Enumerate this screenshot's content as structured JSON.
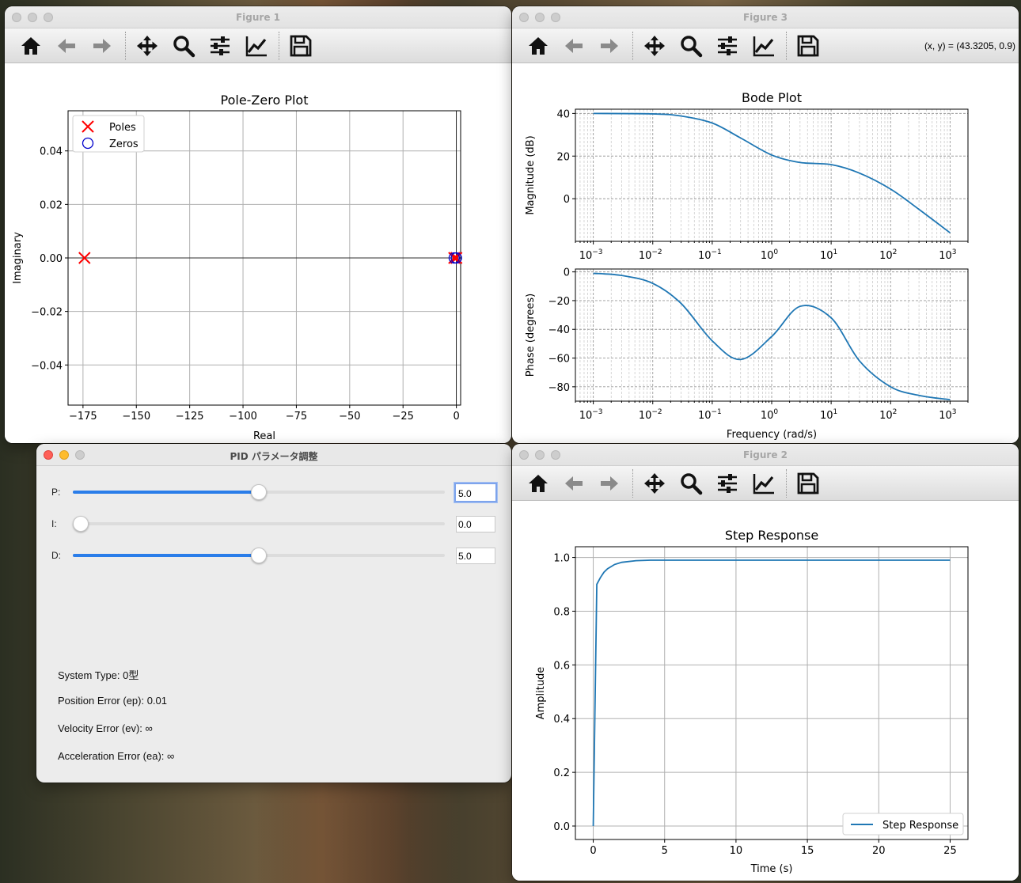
{
  "figure1": {
    "title": "Figure 1",
    "chart_data": {
      "type": "scatter",
      "title": "Pole-Zero Plot",
      "xlabel": "Real",
      "ylabel": "Imaginary",
      "xlim": [
        -182,
        2
      ],
      "ylim": [
        -0.055,
        0.055
      ],
      "xticks": [
        -175,
        -150,
        -125,
        -100,
        -75,
        -50,
        -25,
        0
      ],
      "xtick_labels": [
        "−175",
        "−150",
        "−125",
        "−100",
        "−75",
        "−50",
        "−25",
        "0"
      ],
      "yticks": [
        -0.04,
        -0.02,
        0.0,
        0.02,
        0.04
      ],
      "ytick_labels": [
        "−0.04",
        "−0.02",
        "0.00",
        "0.02",
        "0.04"
      ],
      "grid": true,
      "legend": "top-left",
      "series": [
        {
          "name": "Poles",
          "marker": "x",
          "color": "#ff0000",
          "x": [
            -174.3,
            -1.0,
            0.0
          ],
          "y": [
            0,
            0,
            0
          ]
        },
        {
          "name": "Zeros",
          "marker": "o",
          "color": "#0000cc",
          "x": [
            -1.0,
            0.0
          ],
          "y": [
            0,
            0
          ]
        }
      ]
    }
  },
  "figure3": {
    "title": "Figure 3",
    "coords": "(x, y) = (43.3205, 0.9)",
    "chart_data": [
      {
        "type": "line",
        "title": "Bode Plot",
        "xlabel": "",
        "ylabel": "Magnitude (dB)",
        "xscale": "log",
        "xlim": [
          0.0005,
          2000
        ],
        "ylim": [
          -20,
          42
        ],
        "yticks": [
          0,
          20,
          40
        ],
        "ytick_labels": [
          "0",
          "20",
          "40"
        ],
        "grid": true,
        "color": "#1f77b4",
        "x": [
          0.001,
          0.01,
          0.03,
          0.1,
          0.3,
          1,
          3,
          10,
          30,
          100,
          300,
          1000
        ],
        "values": [
          40,
          39.8,
          38.8,
          35.5,
          28.5,
          20.5,
          17.0,
          16.0,
          12.0,
          4.5,
          -5.0,
          -16.0
        ]
      },
      {
        "type": "line",
        "title": "",
        "xlabel": "Frequency (rad/s)",
        "ylabel": "Phase (degrees)",
        "xscale": "log",
        "xlim": [
          0.0005,
          2000
        ],
        "ylim": [
          -90,
          2
        ],
        "yticks": [
          -80,
          -60,
          -40,
          -20,
          0
        ],
        "ytick_labels": [
          "−80",
          "−60",
          "−40",
          "−20",
          "0"
        ],
        "xtick_labels": [
          "10",
          "10",
          "10",
          "10",
          "10",
          "10",
          "10"
        ],
        "xtick_exps": [
          "−3",
          "−2",
          "−1",
          "0",
          "1",
          "2",
          "3"
        ],
        "grid": true,
        "color": "#1f77b4",
        "x": [
          0.001,
          0.003,
          0.01,
          0.03,
          0.1,
          0.3,
          1,
          3,
          10,
          30,
          100,
          300,
          1000
        ],
        "values": [
          -1,
          -2.5,
          -8,
          -22,
          -48,
          -61,
          -45,
          -24,
          -32,
          -62,
          -80,
          -86,
          -89
        ]
      }
    ]
  },
  "figure2": {
    "title": "Figure 2",
    "chart_data": {
      "type": "line",
      "title": "Step Response",
      "xlabel": "Time (s)",
      "ylabel": "Amplitude",
      "xlim": [
        -1.25,
        26.25
      ],
      "ylim": [
        -0.05,
        1.04
      ],
      "xticks": [
        0,
        5,
        10,
        15,
        20,
        25
      ],
      "xtick_labels": [
        "0",
        "5",
        "10",
        "15",
        "20",
        "25"
      ],
      "yticks": [
        0.0,
        0.2,
        0.4,
        0.6,
        0.8,
        1.0
      ],
      "ytick_labels": [
        "0.0",
        "0.2",
        "0.4",
        "0.6",
        "0.8",
        "1.0"
      ],
      "grid": true,
      "legend": "bottom-right",
      "color": "#1f77b4",
      "series": [
        {
          "name": "Step Response",
          "x": [
            0,
            0.25,
            0.5,
            0.75,
            1,
            1.5,
            2,
            3,
            4,
            5,
            10,
            15,
            20,
            25
          ],
          "values": [
            0,
            0.9,
            0.925,
            0.945,
            0.958,
            0.974,
            0.982,
            0.988,
            0.99,
            0.99,
            0.99,
            0.99,
            0.99,
            0.99
          ]
        }
      ]
    }
  },
  "pid": {
    "title": "PID パラメータ調整",
    "sliders": [
      {
        "label": "P:",
        "value": "5.0",
        "fraction": 0.5
      },
      {
        "label": "I:",
        "value": "0.0",
        "fraction": 0.0
      },
      {
        "label": "D:",
        "value": "5.0",
        "fraction": 0.5
      }
    ],
    "info": [
      "System Type: 0型",
      "Position Error (ep): 0.01",
      "Velocity Error (ev): ∞",
      "Acceleration Error (ea): ∞"
    ]
  }
}
